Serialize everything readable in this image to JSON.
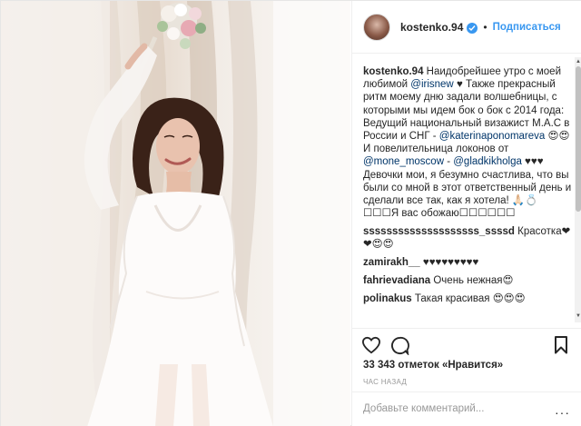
{
  "post": {
    "username": "kostenko.94",
    "follow_label": "Подписаться",
    "separator": "•"
  },
  "caption": {
    "user": "kostenko.94",
    "text1": " Наидобрейшее утро с моей любимой ",
    "mention1": "@irisnew",
    "text2": " ♥ Также прекрасный ритм моему дню задали волшебницы, с которыми мы идем бок о бок с 2014 года: Ведущий национальный визажист M.A.C в России и СНГ - ",
    "mention2": "@katerinaponomareva",
    "text3": " 😍😍 И повелительница локонов от ",
    "mention3": "@mone_moscow",
    "text4": " - ",
    "mention4": "@gladkikholga",
    "text5": " ♥♥♥ Девочки мои, я безумно счастлива, что вы были со мной в этот ответственный день и сделали все так, как я хотела! 🙏🏻💍 ☐☐☐Я вас обожаю☐☐☐☐☐☐"
  },
  "comments": [
    {
      "user": "ssssssssssssssssssss_ssssd",
      "text": "Красотка❤❤😍😍"
    },
    {
      "user": "zamirakh__",
      "text": "♥♥♥♥♥♥♥♥♥"
    },
    {
      "user": "fahrievadiana",
      "text": "Очень нежная😍"
    },
    {
      "user": "polinakus",
      "text": "Такая красивая 😍😍😍"
    }
  ],
  "stats": {
    "likes": "33 343 отметок «Нравится»",
    "time": "ЧАС НАЗАД"
  },
  "comment_box": {
    "placeholder": "Добавьте комментарий...",
    "more": "···"
  },
  "icons": {
    "like": "heart-icon",
    "comment": "comment-bubble-icon",
    "save": "bookmark-icon",
    "verified": "verified-badge-icon"
  },
  "colors": {
    "link": "#3897f0",
    "mention": "#003569",
    "meta": "#999999"
  }
}
